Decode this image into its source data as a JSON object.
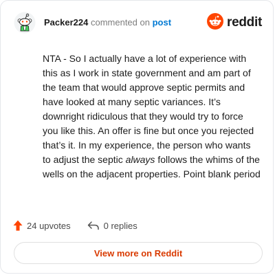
{
  "comment": {
    "username": "Packer224",
    "action_text": "commented on",
    "post_link": "post",
    "body_before": "NTA - So I actually have a lot of experience with this as I work in state government and am part of the team that would approve septic permits and have looked at many septic variances. It’s downright ridiculous that they would try to force you like this. An offer is fine but once you rejected that’s it. In my experience, the person who wants to adjust the septic ",
    "body_emphasis": "always",
    "body_after": " follows the whims of the wells on the adjacent properties. Point blank period"
  },
  "brand": {
    "name": "reddit",
    "color": "#ff4500"
  },
  "stats": {
    "upvotes": "24 upvotes",
    "replies": "0 replies"
  },
  "footer": {
    "view_more": "View more on Reddit"
  },
  "icons": {
    "avatar": "snoo-avatar-icon",
    "brand": "reddit-logo-icon",
    "upvote": "upvote-arrow-icon",
    "reply": "reply-arrow-icon"
  },
  "colors": {
    "accent": "#d93a00",
    "link": "#0079d3",
    "upvote": "#ff4500"
  }
}
